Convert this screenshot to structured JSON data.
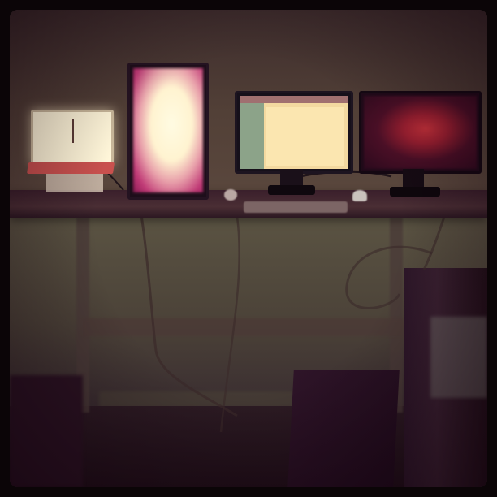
{
  "scene": {
    "description_label": "",
    "colors": {
      "border": "#0b0507",
      "wall": "#524037",
      "desk": "#3a1f2b",
      "laptop_screen": "#fff6d9",
      "laptop_base": "#c9514e",
      "portrait_screen_glow": "#c03a76",
      "middle_screen": "#f3d9a0",
      "right_screen_accent": "#c4313a"
    }
  },
  "middle_monitor": {
    "label_text": "▪️▪️"
  }
}
